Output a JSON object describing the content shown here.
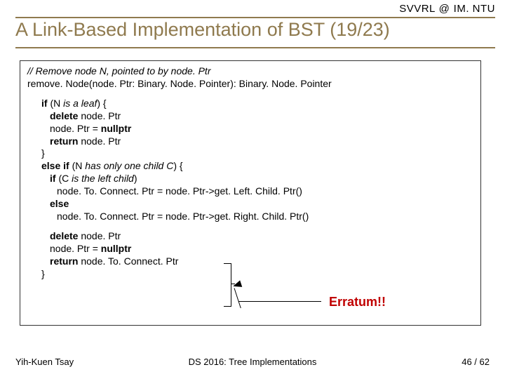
{
  "header": {
    "lab": "SVVRL",
    "at": "@",
    "org": "IM. NTU",
    "title": "A Link-Based Implementation of BST (19/23)"
  },
  "code": {
    "comment1": "// Remove node N, pointed to by node. Ptr",
    "sig": "remove. Node(node. Ptr: Binary. Node. Pointer): Binary. Node. Pointer",
    "l1a_kw": "if",
    "l1a_txt": " (N ",
    "l1a_it": "is a leaf",
    "l1a_end": ") {",
    "l1b_kw": "delete",
    "l1b_txt": " node. Ptr",
    "l1c": "node. Ptr = ",
    "l1c_kw": "nullptr",
    "l1d_kw": "return",
    "l1d_txt": " node. Ptr",
    "l1e": "}",
    "l2a_kw": "else if",
    "l2a_txt": " (N ",
    "l2a_it": "has only one child C",
    "l2a_end": ") {",
    "l2b_kw": "if",
    "l2b_txt": " (C ",
    "l2b_it": "is the left child",
    "l2b_end": ")",
    "l2c": "node. To. Connect. Ptr = node. Ptr->get. Left. Child. Ptr()",
    "l2d_kw": "else",
    "l2e": "node. To. Connect. Ptr = node. Ptr->get. Right. Child. Ptr()",
    "l3a_kw": "delete",
    "l3a_txt": " node. Ptr",
    "l3b": "node. Ptr = ",
    "l3b_kw": "nullptr",
    "l3c_kw": "return",
    "l3c_txt": " node. To. Connect. Ptr",
    "l3d": "}"
  },
  "erratum": "Erratum!!",
  "footer": {
    "left": "Yih-Kuen Tsay",
    "center": "DS 2016: Tree Implementations",
    "right": "46 / 62"
  }
}
